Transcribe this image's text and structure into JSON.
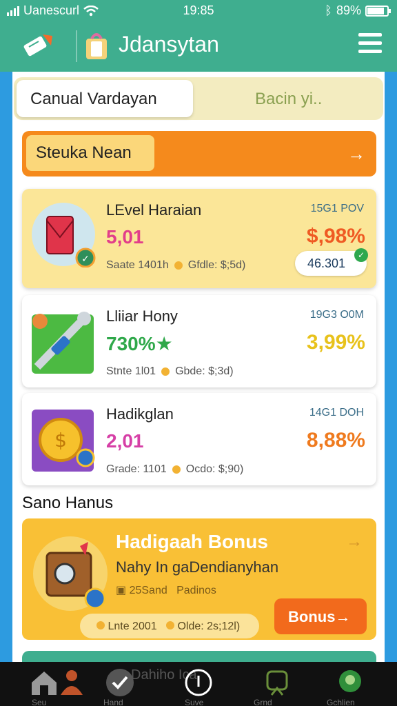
{
  "status": {
    "carrier": "Uanescurl",
    "time": "19:85",
    "battery": "89%"
  },
  "header": {
    "title": "Jdansytan"
  },
  "tabs": {
    "active": "Canual Vardayan",
    "inactive": "Bacin yi.."
  },
  "banner": {
    "label": "Steuka Nean",
    "arrow": "→"
  },
  "items": [
    {
      "name": "LEvel Haraian",
      "value": "5,01",
      "meta_a": "Saate 1401h",
      "meta_b": "Gfdle: $;5d)",
      "time": "15G1 POV",
      "pct": "$,98%",
      "pill": "46.301",
      "value_color": "#e23e8a",
      "pct_color": "#ef5a23"
    },
    {
      "name": "Lliiar Hony",
      "value": "730%★",
      "meta_a": "Stnte 1l01",
      "meta_b": "Gbde: $;3d)",
      "time": "19G3 O0M",
      "pct": "3,99%",
      "value_color": "#2fa84a",
      "pct_color": "#e8c21c"
    },
    {
      "name": "Hadikglan",
      "value": "2,01",
      "meta_a": "Grade: 1101",
      "meta_b": "Ocdo: $;90)",
      "time": "14G1 DOH",
      "pct": "8,88%",
      "value_color": "#d63fa6",
      "pct_color": "#ef7a1e"
    }
  ],
  "section": {
    "title": "Sano Hanus"
  },
  "bonus": {
    "title": "Hadigaah Bonus",
    "subtitle": "Nahy In gaDendianyhan",
    "meta_a": "25Sand",
    "meta_b": "Padinos",
    "foot_a": "Lnte 2001",
    "foot_b": "Olde: 2s;12l)",
    "button": "Bonus→",
    "arrow": "→"
  },
  "nav": {
    "faint_text": "Dahiho Ica",
    "labels": [
      "Seu",
      "Hand",
      "Suve",
      "Grnd",
      "Gchlien"
    ]
  },
  "colors": {
    "header_bg": "#3fae8f",
    "frame_bg": "#2d9be0",
    "accent_orange": "#f58a1c",
    "bonus_bg": "#f9c036"
  }
}
